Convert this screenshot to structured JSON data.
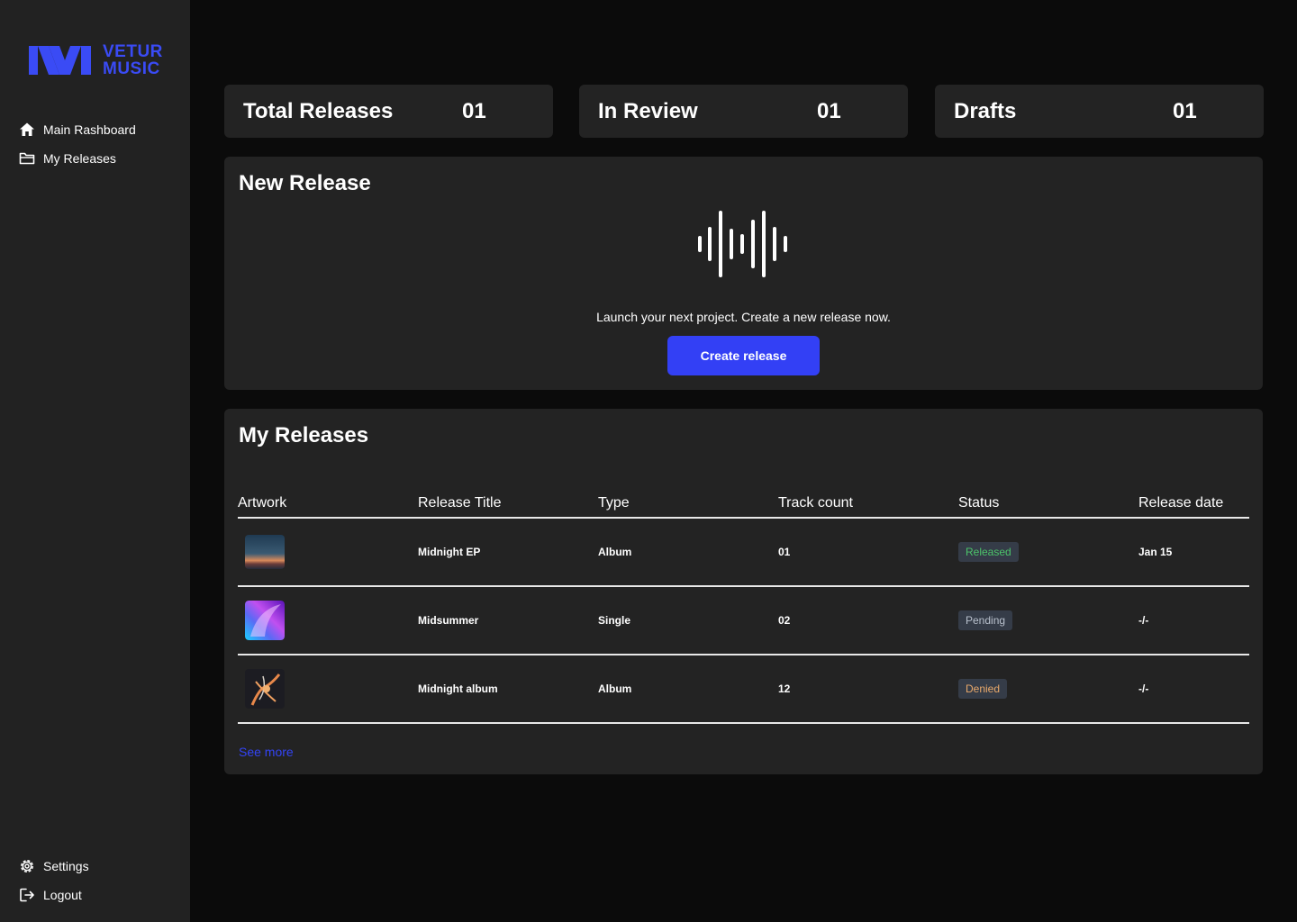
{
  "brand": {
    "line1": "VETUR",
    "line2": "MUSIC",
    "color": "#3a4bf5"
  },
  "sidebar": {
    "items": [
      {
        "label": "Main Rashboard",
        "icon": "home-icon"
      },
      {
        "label": "My Releases",
        "icon": "folder-icon"
      }
    ],
    "bottom_items": [
      {
        "label": "Settings",
        "icon": "gear-icon"
      },
      {
        "label": "Logout",
        "icon": "logout-icon"
      }
    ]
  },
  "stats": [
    {
      "label": "Total Releases",
      "value": "01"
    },
    {
      "label": "In Review",
      "value": "01"
    },
    {
      "label": "Drafts",
      "value": "01"
    }
  ],
  "new_release": {
    "title": "New Release",
    "icon": "waveform-icon",
    "text": "Launch your next project. Create a new release now.",
    "button": "Create release",
    "button_color": "#3340f5"
  },
  "my_releases": {
    "title": "My Releases",
    "columns": [
      "Artwork",
      "Release Title",
      "Type",
      "Track count",
      "Status",
      "Release date"
    ],
    "rows": [
      {
        "artwork": "sunset-artwork",
        "title": "Midnight EP",
        "type": "Album",
        "tracks": "01",
        "status": "Released",
        "status_color": "#4cc46a",
        "date": "Jan 15"
      },
      {
        "artwork": "gradient-artwork",
        "title": "Midsummer",
        "type": "Single",
        "tracks": "02",
        "status": "Pending",
        "status_color": "#b8c0cc",
        "date": "-/-"
      },
      {
        "artwork": "coral-artwork",
        "title": "Midnight album",
        "type": "Album",
        "tracks": "12",
        "status": "Denied",
        "status_color": "#e8a86a",
        "date": "-/-"
      }
    ],
    "see_more": "See more"
  }
}
